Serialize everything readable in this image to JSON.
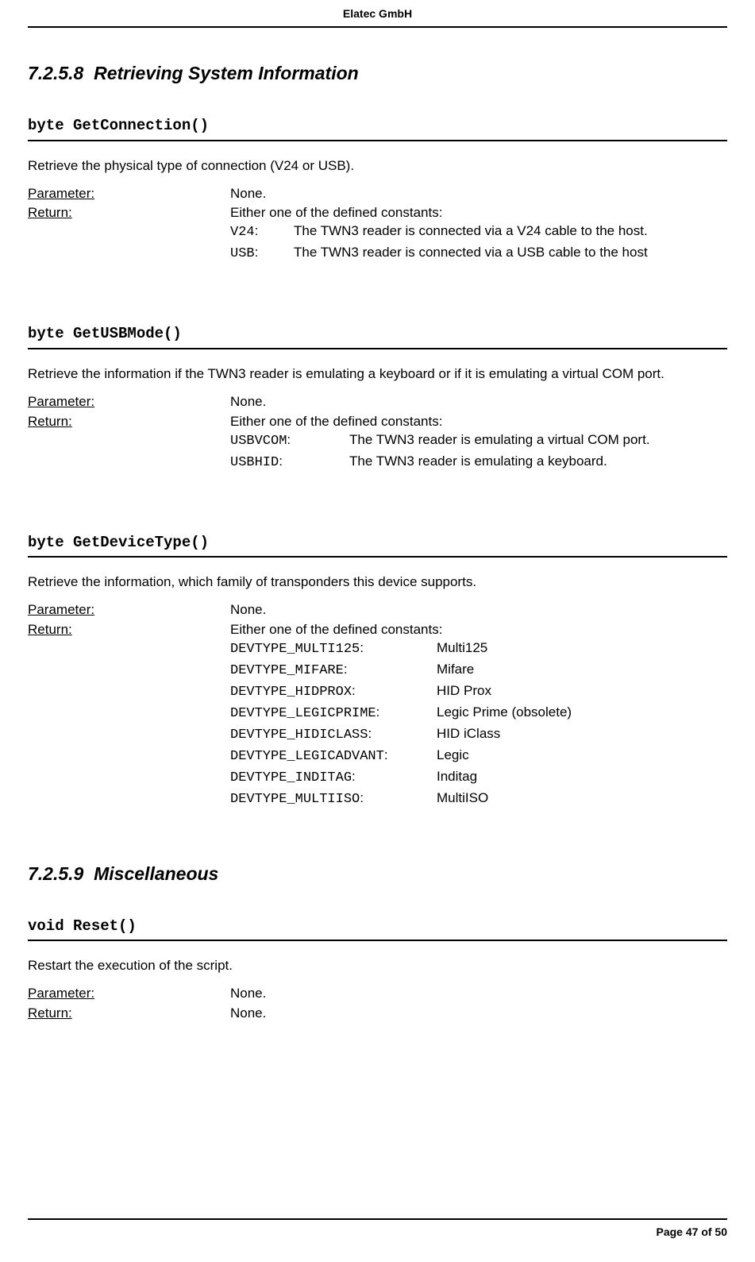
{
  "header": {
    "company": "Elatec GmbH"
  },
  "footer": {
    "page": "Page 47 of 50"
  },
  "section1": {
    "number": "7.2.5.8",
    "title": "Retrieving System Information"
  },
  "func1": {
    "sig": "byte GetConnection()",
    "desc": "Retrieve the physical type of connection (V24 or USB).",
    "param_label": "Parameter:",
    "param_value": "None.",
    "return_label": "Return:",
    "return_intro": "Either one of the defined constants:",
    "consts": [
      {
        "code": "V24",
        "sep": ":",
        "desc": "The TWN3 reader is connected via a V24 cable to the host."
      },
      {
        "code": "USB",
        "sep": ":",
        "desc": "The TWN3 reader is connected via a USB cable to the host"
      }
    ]
  },
  "func2": {
    "sig": "byte GetUSBMode()",
    "desc": "Retrieve the information if the TWN3 reader is emulating a keyboard or if it is emulating a virtual COM port.",
    "param_label": "Parameter:",
    "param_value": "None.",
    "return_label": "Return:",
    "return_intro": "Either one of the defined constants:",
    "consts": [
      {
        "code": "USBVCOM",
        "sep": ":",
        "desc": "The TWN3 reader is emulating a virtual COM port."
      },
      {
        "code": "USBHID",
        "sep": ":",
        "desc": "The TWN3 reader is emulating a keyboard."
      }
    ]
  },
  "func3": {
    "sig": "byte GetDeviceType()",
    "desc": "Retrieve the information, which family of transponders this device supports.",
    "param_label": "Parameter:",
    "param_value": "None.",
    "return_label": "Return:",
    "return_intro": "Either one of the defined constants:",
    "consts": [
      {
        "code": "DEVTYPE_MULTI125",
        "sep": ":",
        "desc": "Multi125"
      },
      {
        "code": "DEVTYPE_MIFARE",
        "sep": ":",
        "desc": "Mifare"
      },
      {
        "code": "DEVTYPE_HIDPROX",
        "sep": ":",
        "desc": "HID Prox"
      },
      {
        "code": "DEVTYPE_LEGICPRIME",
        "sep": ":",
        "desc": "Legic Prime (obsolete)"
      },
      {
        "code": "DEVTYPE_HIDICLASS",
        "sep": ":",
        "desc": "HID iClass"
      },
      {
        "code": "DEVTYPE_LEGICADVANT",
        "sep": ":",
        "desc": "Legic"
      },
      {
        "code": "DEVTYPE_INDITAG",
        "sep": ":",
        "desc": "Inditag"
      },
      {
        "code": "DEVTYPE_MULTIISO",
        "sep": ":",
        "desc": "MultiISO"
      }
    ]
  },
  "section2": {
    "number": "7.2.5.9",
    "title": "Miscellaneous"
  },
  "func4": {
    "sig": "void Reset()",
    "desc": "Restart the execution of the script.",
    "param_label": "Parameter:",
    "param_value": "None.",
    "return_label": "Return:",
    "return_value": "None."
  }
}
